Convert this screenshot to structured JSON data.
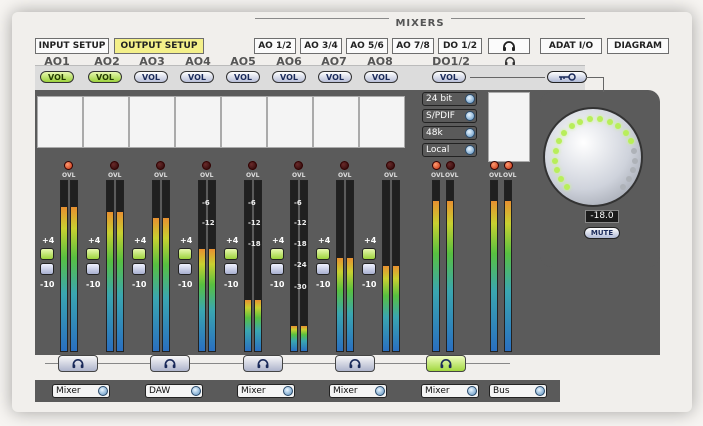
{
  "mixers_group_label": "MIXERS",
  "tabs": [
    {
      "id": "input-setup",
      "label": "INPUT SETUP",
      "active": false
    },
    {
      "id": "output-setup",
      "label": "OUTPUT SETUP",
      "active": true
    },
    {
      "id": "ao-1-2",
      "label": "AO 1/2",
      "active": false
    },
    {
      "id": "ao-3-4",
      "label": "AO 3/4",
      "active": false
    },
    {
      "id": "ao-5-6",
      "label": "AO 5/6",
      "active": false
    },
    {
      "id": "ao-7-8",
      "label": "AO 7/8",
      "active": false
    },
    {
      "id": "do-1-2",
      "label": "DO 1/2",
      "active": false
    },
    {
      "id": "headphones",
      "label": "",
      "icon": "headphones-icon",
      "active": false
    },
    {
      "id": "adat-io",
      "label": "ADAT I/O",
      "active": false
    },
    {
      "id": "diagram",
      "label": "DIAGRAM",
      "active": false
    }
  ],
  "channels": [
    {
      "label": "AO1",
      "vol_label": "VOL",
      "vol_active": true,
      "ovl_lit": true
    },
    {
      "label": "AO2",
      "vol_label": "VOL",
      "vol_active": true,
      "ovl_lit": false
    },
    {
      "label": "AO3",
      "vol_label": "VOL",
      "vol_active": false,
      "ovl_lit": false
    },
    {
      "label": "AO4",
      "vol_label": "VOL",
      "vol_active": false,
      "ovl_lit": false
    },
    {
      "label": "AO5",
      "vol_label": "VOL",
      "vol_active": false,
      "ovl_lit": false
    },
    {
      "label": "AO6",
      "vol_label": "VOL",
      "vol_active": false,
      "ovl_lit": false
    },
    {
      "label": "AO7",
      "vol_label": "VOL",
      "vol_active": false,
      "ovl_lit": false
    },
    {
      "label": "AO8",
      "vol_label": "VOL",
      "vol_active": false,
      "ovl_lit": false
    }
  ],
  "digital_out": {
    "label": "DO1/2",
    "vol_label": "VOL"
  },
  "ovl_label": "OVL",
  "meter_scale": [
    "+4",
    "-6",
    "-12",
    "-18",
    "-24",
    "-30"
  ],
  "gain_high": "+4",
  "gain_low": "-10",
  "digital_settings": [
    {
      "name": "bit-depth",
      "value": "24 bit"
    },
    {
      "name": "format",
      "value": "S/PDIF"
    },
    {
      "name": "sample-rate",
      "value": "48k"
    },
    {
      "name": "clock",
      "value": "Local"
    }
  ],
  "monitor": {
    "volume_readout": "-18.0",
    "mute_label": "MUTE"
  },
  "routing": [
    {
      "value": "Mixer"
    },
    {
      "value": "DAW"
    },
    {
      "value": "Mixer"
    },
    {
      "value": "Mixer"
    },
    {
      "value": "Mixer"
    },
    {
      "value": "Bus"
    }
  ],
  "colors": {
    "accent_active": "#9cd23c",
    "tab_active": "#f4f08a",
    "panel": "#5b5b5b"
  }
}
